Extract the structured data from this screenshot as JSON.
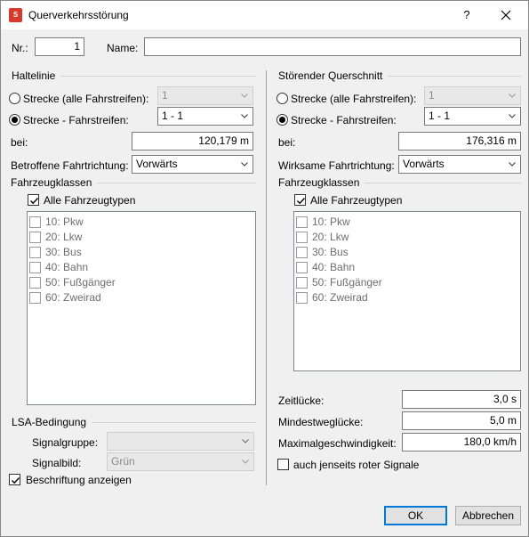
{
  "window": {
    "title": "Querverkehrsstörung",
    "app_icon_text": "S",
    "help": "?"
  },
  "top": {
    "nr_label": "Nr.:",
    "nr_value": "1",
    "name_label": "Name:",
    "name_value": ""
  },
  "left": {
    "group_title": "Haltelinie",
    "radio_all_label": "Strecke (alle Fahrstreifen):",
    "radio_all_value": "1",
    "radio_lane_label": "Strecke - Fahrstreifen:",
    "radio_lane_value": "1 - 1",
    "bei_label": "bei:",
    "bei_value": "120,179 m",
    "direction_label": "Betroffene Fahrtrichtung:",
    "direction_value": "Vorwärts",
    "vehicle_classes_title": "Fahrzeugklassen",
    "all_types_label": "Alle Fahrzeugtypen",
    "vehicle_list": [
      "10: Pkw",
      "20: Lkw",
      "30: Bus",
      "40: Bahn",
      "50: Fußgänger",
      "60: Zweirad"
    ],
    "lsa_title": "LSA-Bedingung",
    "signal_group_label": "Signalgruppe:",
    "signal_group_value": "",
    "signal_image_label": "Signalbild:",
    "signal_image_value": "Grün",
    "show_label_text": "Beschriftung anzeigen"
  },
  "right": {
    "group_title": "Störender Querschnitt",
    "radio_all_label": "Strecke (alle Fahrstreifen):",
    "radio_all_value": "1",
    "radio_lane_label": "Strecke - Fahrstreifen:",
    "radio_lane_value": "1 - 1",
    "bei_label": "bei:",
    "bei_value": "176,316 m",
    "direction_label": "Wirksame Fahrtrichtung:",
    "direction_value": "Vorwärts",
    "vehicle_classes_title": "Fahrzeugklassen",
    "all_types_label": "Alle Fahrzeugtypen",
    "vehicle_list": [
      "10: Pkw",
      "20: Lkw",
      "30: Bus",
      "40: Bahn",
      "50: Fußgänger",
      "60: Zweirad"
    ],
    "gap_time_label": "Zeitlücke:",
    "gap_time_value": "3,0 s",
    "min_gap_label": "Mindestweglücke:",
    "min_gap_value": "5,0 m",
    "max_speed_label": "Maximalgeschwindigkeit:",
    "max_speed_value": "180,0 km/h",
    "beyond_red_label": "auch jenseits roter Signale"
  },
  "buttons": {
    "ok": "OK",
    "cancel": "Abbrechen"
  }
}
